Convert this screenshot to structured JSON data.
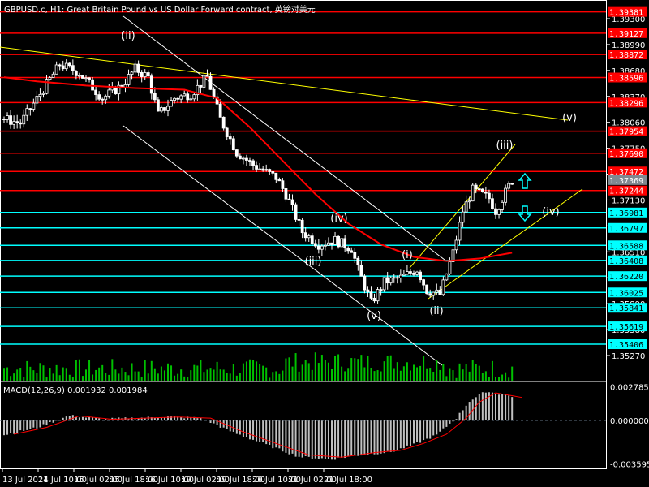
{
  "header": {
    "title": "GBPUSD.c, H1:  Great Britain Pound vs US Dollar Forward contract, 英镑对美元"
  },
  "macd_label": "MACD(12,26,9) 0.001932 0.001984",
  "colors": {
    "bg": "#000000",
    "red": "#ff0000",
    "cyan": "#00ffff",
    "yellow": "#ffff00",
    "candle": "#ffffff",
    "volume": "#00c000",
    "macd": "#c0c0c0"
  },
  "chart_data": {
    "type": "candlestick",
    "symbol": "GBPUSD.c",
    "timeframe": "H1",
    "ylim": [
      1.351,
      1.3945
    ],
    "price_ticks": [
      "1.39300",
      "1.38990",
      "1.38680",
      "1.38370",
      "1.38060",
      "1.37750",
      "1.37440",
      "1.37130",
      "1.36820",
      "1.36510",
      "1.36200",
      "1.35890",
      "1.35580",
      "1.35270"
    ],
    "red_levels": [
      "1.39381",
      "1.39127",
      "1.38872",
      "1.38596",
      "1.38296",
      "1.37954",
      "1.37690",
      "1.37472",
      "1.37244"
    ],
    "current_price": "1.37369",
    "cyan_levels": [
      "1.36981",
      "1.36797",
      "1.36588",
      "1.36408",
      "1.36220",
      "1.36025",
      "1.35841",
      "1.35619",
      "1.35406"
    ],
    "x_labels": [
      "13 Jul 2021",
      "14 Jul 10:00",
      "15 Jul 02:00",
      "15 Jul 18:00",
      "16 Jul 10:00",
      "19 Jul 02:00",
      "19 Jul 18:00",
      "20 Jul 10:00",
      "21 Jul 02:00",
      "21 Jul 18:00"
    ],
    "close_path": [
      [
        0,
        1.381
      ],
      [
        5,
        1.3805
      ],
      [
        11,
        1.384
      ],
      [
        17,
        1.3875
      ],
      [
        23,
        1.3865
      ],
      [
        30,
        1.3835
      ],
      [
        36,
        1.385
      ],
      [
        40,
        1.387
      ],
      [
        44,
        1.386
      ],
      [
        47,
        1.3815
      ],
      [
        52,
        1.3835
      ],
      [
        57,
        1.384
      ],
      [
        62,
        1.386
      ],
      [
        66,
        1.381
      ],
      [
        71,
        1.377
      ],
      [
        76,
        1.3755
      ],
      [
        83,
        1.374
      ],
      [
        86,
        1.372
      ],
      [
        91,
        1.3675
      ],
      [
        96,
        1.366
      ],
      [
        101,
        1.3665
      ],
      [
        106,
        1.3655
      ],
      [
        108,
        1.363
      ],
      [
        112,
        1.359
      ],
      [
        116,
        1.3615
      ],
      [
        121,
        1.362
      ],
      [
        126,
        1.363
      ],
      [
        129,
        1.3605
      ],
      [
        133,
        1.36
      ],
      [
        137,
        1.365
      ],
      [
        140,
        1.37
      ],
      [
        143,
        1.3725
      ],
      [
        148,
        1.3715
      ],
      [
        150,
        1.37
      ],
      [
        155,
        1.3737
      ]
    ],
    "ma_path": [
      [
        0,
        1.386
      ],
      [
        10,
        1.3855
      ],
      [
        25,
        1.385
      ],
      [
        40,
        1.3847
      ],
      [
        55,
        1.3845
      ],
      [
        65,
        1.3835
      ],
      [
        75,
        1.38
      ],
      [
        85,
        1.376
      ],
      [
        95,
        1.372
      ],
      [
        105,
        1.3685
      ],
      [
        115,
        1.366
      ],
      [
        125,
        1.3645
      ],
      [
        135,
        1.364
      ],
      [
        145,
        1.3643
      ],
      [
        155,
        1.365
      ]
    ],
    "macd": {
      "ylim": [
        -0.003595,
        0.002785
      ],
      "ticks": [
        "0.002785",
        "0.000000",
        "-0.003595"
      ],
      "hist_path": [
        [
          0,
          -0.0012
        ],
        [
          10,
          -0.0006
        ],
        [
          20,
          0.0004
        ],
        [
          30,
          0.0001
        ],
        [
          40,
          0.0002
        ],
        [
          50,
          0.0003
        ],
        [
          60,
          0.0002
        ],
        [
          70,
          -0.001
        ],
        [
          80,
          -0.002
        ],
        [
          90,
          -0.003
        ],
        [
          100,
          -0.0032
        ],
        [
          110,
          -0.0028
        ],
        [
          118,
          -0.0026
        ],
        [
          125,
          -0.002
        ],
        [
          132,
          -0.0012
        ],
        [
          138,
          0.0002
        ],
        [
          142,
          0.0016
        ],
        [
          147,
          0.0024
        ],
        [
          155,
          0.002
        ]
      ]
    },
    "wave_labels": [
      "(ii)",
      "(iii)",
      "(iv)",
      "(v)",
      "(i)",
      "(ii)",
      "(iii)",
      "(iv)",
      "(v)"
    ]
  }
}
